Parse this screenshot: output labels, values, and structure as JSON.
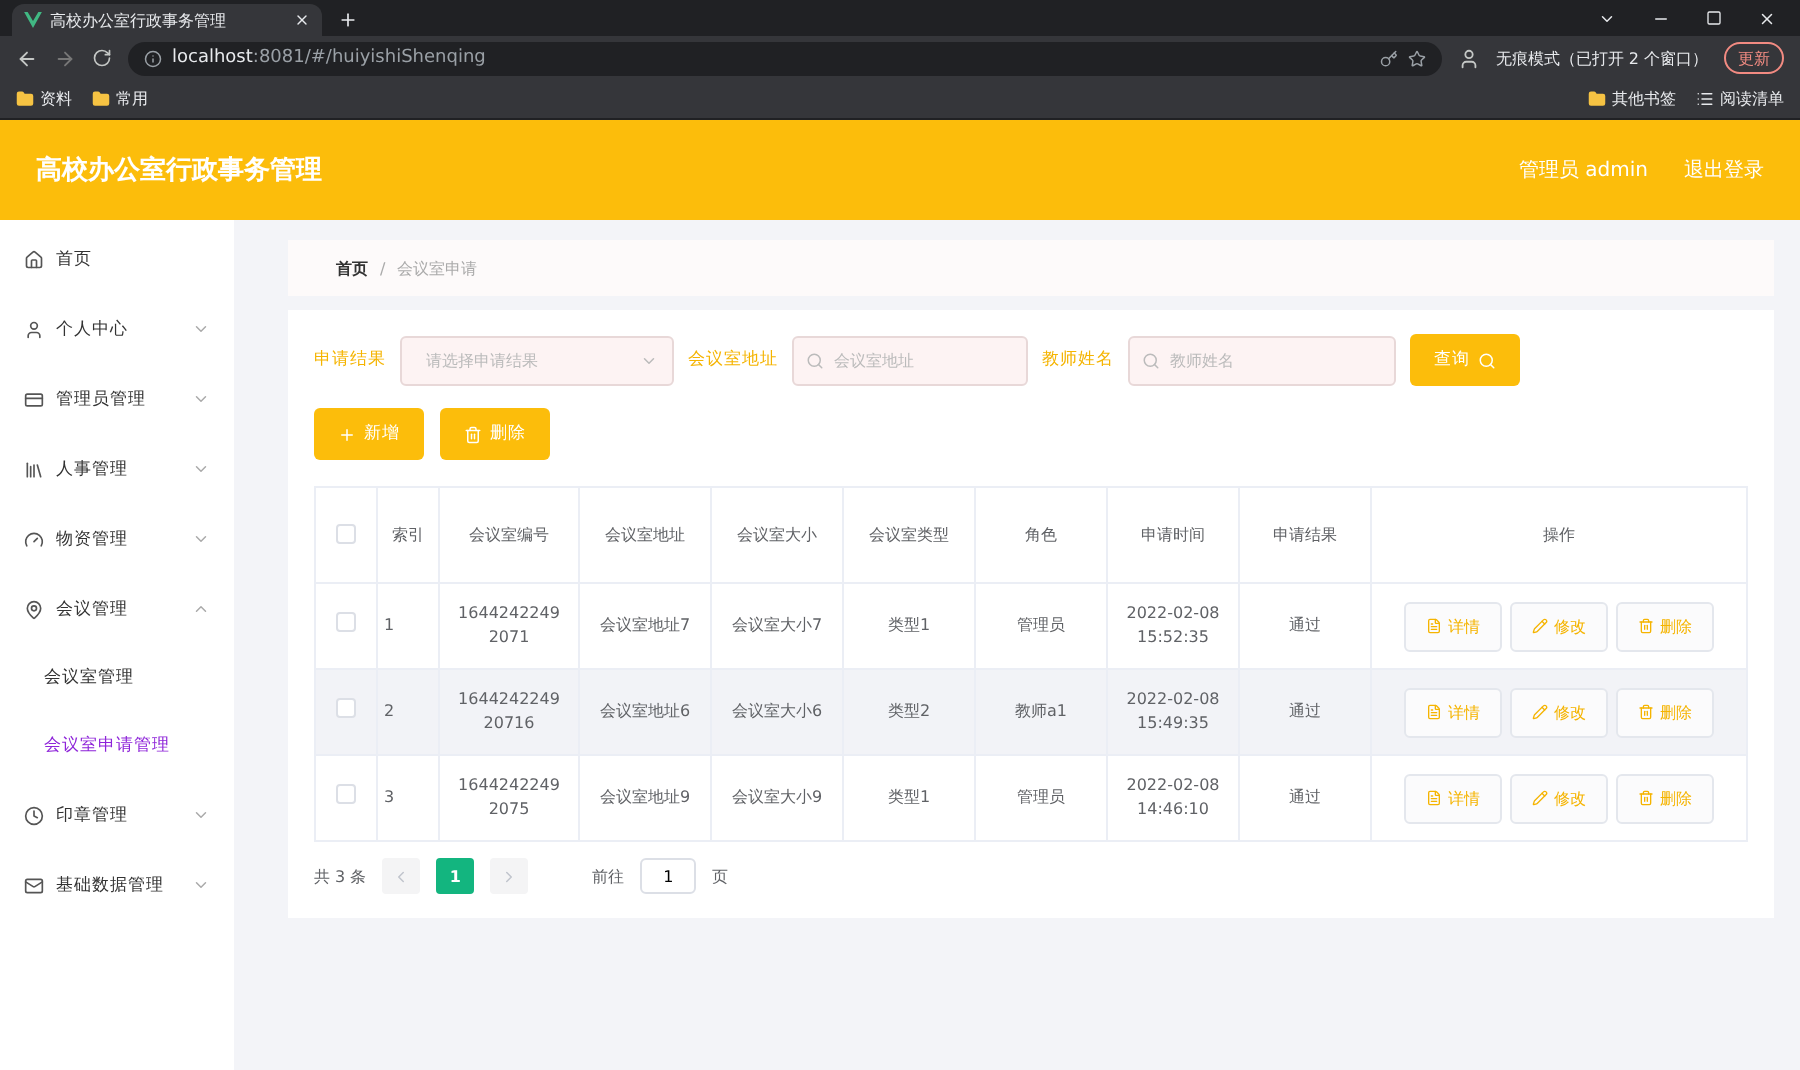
{
  "browser": {
    "tab_title": "高校办公室行政事务管理",
    "url_host": "localhost",
    "url_rest": ":8081/#/huiyishiShenqing",
    "profile": "无痕模式（已打开 2 个窗口）",
    "update": "更新",
    "bookmarks_left": [
      "资料",
      "常用"
    ],
    "bookmarks_right": [
      "其他书签",
      "阅读清单"
    ]
  },
  "header": {
    "title": "高校办公室行政事务管理",
    "user": "管理员 admin",
    "logout": "退出登录"
  },
  "sidebar": {
    "items": [
      {
        "label": "首页"
      },
      {
        "label": "个人中心",
        "expanded": false
      },
      {
        "label": "管理员管理",
        "expanded": false
      },
      {
        "label": "人事管理",
        "expanded": false
      },
      {
        "label": "物资管理",
        "expanded": false
      },
      {
        "label": "会议管理",
        "expanded": true,
        "children": [
          {
            "label": "会议室管理",
            "selected": false
          },
          {
            "label": "会议室申请管理",
            "selected": true
          }
        ]
      },
      {
        "label": "印章管理",
        "expanded": false
      },
      {
        "label": "基础数据管理",
        "expanded": false
      }
    ]
  },
  "breadcrumb": {
    "items": [
      "首页",
      "会议室申请"
    ],
    "separator": "/"
  },
  "filters": [
    {
      "label": "申请结果",
      "placeholder": "请选择申请结果",
      "kind": "select"
    },
    {
      "label": "会议室地址",
      "placeholder": "会议室地址",
      "kind": "search"
    },
    {
      "label": "教师姓名",
      "placeholder": "教师姓名",
      "kind": "search"
    }
  ],
  "search_button": "查询",
  "actions": [
    {
      "label": "新增",
      "kind": "add"
    },
    {
      "label": "删除",
      "kind": "delete"
    }
  ],
  "table": {
    "columns": [
      "索引",
      "会议室编号",
      "会议室地址",
      "会议室大小",
      "会议室类型",
      "角色",
      "申请时间",
      "申请结果",
      "操作"
    ],
    "header_checked": false,
    "rows": [
      {
        "checked": false,
        "selected": false,
        "cells": [
          "1",
          "1644242249 2071",
          "会议室地址7",
          "会议室大小7",
          "类型1",
          "管理员",
          "2022-02-08 15:52:35",
          "通过"
        ],
        "buttons": [
          "详情",
          "修改",
          "删除"
        ]
      },
      {
        "checked": false,
        "selected": true,
        "cells": [
          "2",
          "1644242249 20716",
          "会议室地址6",
          "会议室大小6",
          "类型2",
          "教师a1",
          "2022-02-08 15:49:35",
          "通过"
        ],
        "buttons": [
          "详情",
          "修改",
          "删除"
        ]
      },
      {
        "checked": false,
        "selected": false,
        "cells": [
          "3",
          "1644242249 2075",
          "会议室地址9",
          "会议室大小9",
          "类型1",
          "管理员",
          "2022-02-08 14:46:10",
          "通过"
        ],
        "buttons": [
          "详情",
          "修改",
          "删除"
        ]
      }
    ]
  },
  "pagination": {
    "total": "共 3 条",
    "pages": [
      {
        "label": "1",
        "selected": true
      }
    ],
    "goto_label": "前往",
    "goto_value": "1",
    "goto_suffix": "页"
  }
}
